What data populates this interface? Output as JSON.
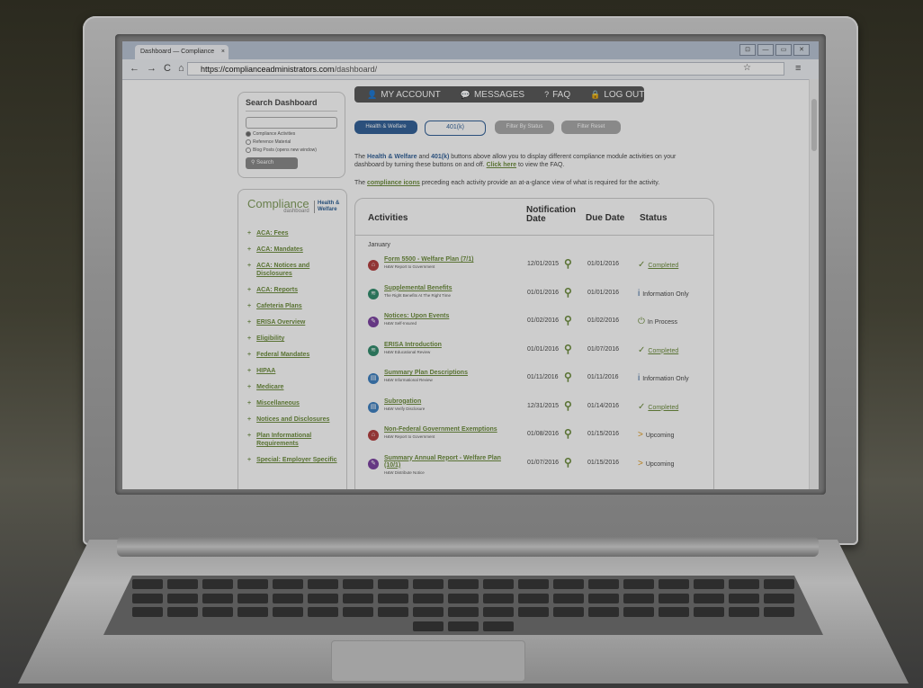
{
  "browser": {
    "tab_title": "Dashboard — Compliance",
    "tab_close": "×",
    "nav_icons": [
      "←",
      "→",
      "C",
      "⌂"
    ],
    "url_host": "https://complianceadministrators.com",
    "url_path": "/dashboard/",
    "bookmark_star": "☆",
    "menu_icon": "≡",
    "window_buttons": [
      "⊡",
      "—",
      "▭",
      "✕"
    ]
  },
  "search": {
    "title": "Search Dashboard",
    "options": [
      {
        "label": "Compliance Activities",
        "selected": true
      },
      {
        "label": "Reference Material",
        "selected": false
      },
      {
        "label": "Blog Posts (opens new window)",
        "selected": false
      }
    ],
    "button": "Search"
  },
  "brand": {
    "logo": "Compliance",
    "logo_sub": "dashboard",
    "tag_line1": "Health &",
    "tag_line2": "Welfare"
  },
  "nav": {
    "bullet": "+",
    "items": [
      "ACA: Fees",
      "ACA: Mandates",
      "ACA: Notices and Disclosures",
      "ACA: Reports",
      "Cafeteria Plans",
      "ERISA Overview",
      "Eligibility",
      "Federal Mandates",
      "HIPAA",
      "Medicare",
      "Miscellaneous",
      "Notices and Disclosures",
      "Plan Informational Requirements",
      "Special: Employer Specific"
    ]
  },
  "topnav": {
    "account": "MY ACCOUNT",
    "messages": "MESSAGES",
    "faq": "FAQ",
    "logout": "LOG OUT"
  },
  "filters": {
    "health_welfare": "Health & Welfare",
    "k401": "401(k)",
    "by_status": "Filter By Status",
    "reset": "Filter Reset"
  },
  "intro": {
    "p1_a": "The ",
    "p1_hw": "Health & Welfare",
    "p1_b": " and ",
    "p1_401k": "401(k)",
    "p1_c": " buttons above allow you to display different compliance module activities on your dashboard by turning these buttons on and off. ",
    "p1_link": "Click here",
    "p1_d": " to view the FAQ.",
    "p2_a": "The ",
    "p2_link": "compliance icons",
    "p2_b": " preceding each activity provide an at-a-glance view of what is required for the activity."
  },
  "table": {
    "headers": {
      "activities": "Activities",
      "notification": "Notification Date",
      "due": "Due Date",
      "status": "Status"
    },
    "month": "January",
    "rows": [
      {
        "icon": "⌂",
        "color": "#b23b3b",
        "title": "Form 5500 - Welfare Plan (7/1)",
        "sub": "H&W Report to Government",
        "notif": "12/01/2015",
        "due": "01/01/2016",
        "status_glyph": "✓",
        "status": "Completed",
        "status_color": "#6b8c3a",
        "link": true
      },
      {
        "icon": "≋",
        "color": "#2e8a6a",
        "title": "Supplemental Benefits",
        "sub": "The Right Benefits At The Right Time",
        "notif": "01/01/2016",
        "due": "01/01/2016",
        "status_glyph": "i",
        "status": "Information Only",
        "status_color": "#2f5f97",
        "link": false
      },
      {
        "icon": "✎",
        "color": "#7a3fa0",
        "title": "Notices: Upon Events",
        "sub": "H&W Self-Insured",
        "notif": "01/02/2016",
        "due": "01/02/2016",
        "status_glyph": "⏻",
        "status": "In Process",
        "status_color": "#6b8c3a",
        "link": false
      },
      {
        "icon": "≋",
        "color": "#2e8a6a",
        "title": "ERISA Introduction",
        "sub": "H&W Educational Review",
        "notif": "01/01/2016",
        "due": "01/07/2016",
        "status_glyph": "✓",
        "status": "Completed",
        "status_color": "#6b8c3a",
        "link": true
      },
      {
        "icon": "▤",
        "color": "#3a7fc0",
        "title": "Summary Plan Descriptions",
        "sub": "H&W Informational Review",
        "notif": "01/11/2016",
        "due": "01/11/2016",
        "status_glyph": "i",
        "status": "Information Only",
        "status_color": "#2f5f97",
        "link": false
      },
      {
        "icon": "▤",
        "color": "#3a7fc0",
        "title": "Subrogation",
        "sub": "H&W Verify Disclosure",
        "notif": "12/31/2015",
        "due": "01/14/2016",
        "status_glyph": "✓",
        "status": "Completed",
        "status_color": "#6b8c3a",
        "link": true
      },
      {
        "icon": "⌂",
        "color": "#b23b3b",
        "title": "Non-Federal Government Exemptions",
        "sub": "H&W Report to Government",
        "notif": "01/08/2016",
        "due": "01/15/2016",
        "status_glyph": ">",
        "status": "Upcoming",
        "status_color": "#e09a1a",
        "link": false
      },
      {
        "icon": "✎",
        "color": "#7a3fa0",
        "title": "Summary Annual Report - Welfare Plan (10/1)",
        "sub": "H&W Distribute Notice",
        "notif": "01/07/2016",
        "due": "01/15/2016",
        "status_glyph": ">",
        "status": "Upcoming",
        "status_color": "#e09a1a",
        "link": false
      }
    ]
  }
}
